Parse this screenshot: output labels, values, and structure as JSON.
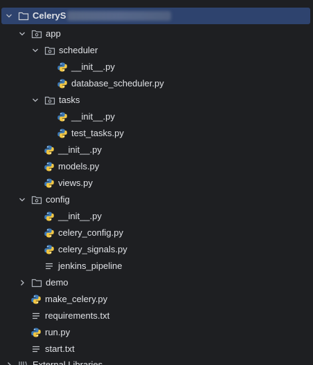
{
  "project_tree": {
    "root": {
      "label": "CeleryS",
      "expanded": true
    },
    "items": [
      {
        "label": "app",
        "type": "package",
        "expanded": true
      },
      {
        "label": "scheduler",
        "type": "package",
        "expanded": true
      },
      {
        "label": "__init__.py",
        "type": "python"
      },
      {
        "label": "database_scheduler.py",
        "type": "python"
      },
      {
        "label": "tasks",
        "type": "package",
        "expanded": true
      },
      {
        "label": "__init__.py",
        "type": "python"
      },
      {
        "label": "test_tasks.py",
        "type": "python"
      },
      {
        "label": "__init__.py",
        "type": "python"
      },
      {
        "label": "models.py",
        "type": "python"
      },
      {
        "label": "views.py",
        "type": "python"
      },
      {
        "label": "config",
        "type": "package",
        "expanded": true
      },
      {
        "label": "__init__.py",
        "type": "python"
      },
      {
        "label": "celery_config.py",
        "type": "python"
      },
      {
        "label": "celery_signals.py",
        "type": "python"
      },
      {
        "label": "jenkins_pipeline",
        "type": "text"
      },
      {
        "label": "demo",
        "type": "folder",
        "expanded": false
      },
      {
        "label": "make_celery.py",
        "type": "python"
      },
      {
        "label": "requirements.txt",
        "type": "text"
      },
      {
        "label": "run.py",
        "type": "python"
      },
      {
        "label": "start.txt",
        "type": "text"
      },
      {
        "label": "External Libraries",
        "type": "library",
        "expanded": false
      }
    ]
  },
  "colors": {
    "background": "#1e1f22",
    "selection": "#2e436e",
    "text": "#dfe1e5",
    "python_blue": "#3d7ab8",
    "python_yellow": "#f2c744",
    "folder_outline": "#aeb3bb"
  }
}
